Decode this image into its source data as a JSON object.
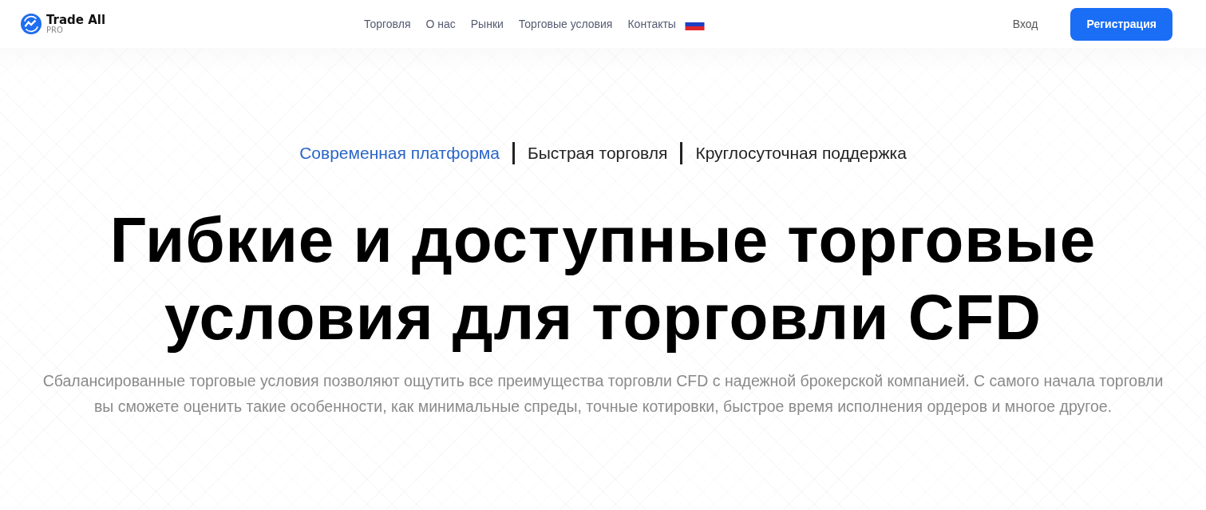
{
  "header": {
    "logo": {
      "name": "Trade All",
      "sub": "PRO"
    },
    "nav": [
      {
        "label": "Торговля"
      },
      {
        "label": "О нас"
      },
      {
        "label": "Рынки"
      },
      {
        "label": "Торговые условия"
      },
      {
        "label": "Контакты"
      }
    ],
    "login": "Вход",
    "register": "Регистрация"
  },
  "hero": {
    "taglines": [
      {
        "text": "Современная платформа",
        "highlighted": true
      },
      {
        "text": "Быстрая торговля",
        "highlighted": false
      },
      {
        "text": "Круглосуточная поддержка",
        "highlighted": false
      }
    ],
    "title_lines": [
      "Гибкие и доступные торговые",
      "условия для торговли CFD"
    ],
    "description": "Сбалансированные торговые условия позволяют ощутить все преимущества торговли CFD с надежной брокерской компанией. С самого начала торговли вы сможете оценить такие особенности, как минимальные спреды, точные котировки, быстрое время исполнения ордеров и многое другое."
  }
}
